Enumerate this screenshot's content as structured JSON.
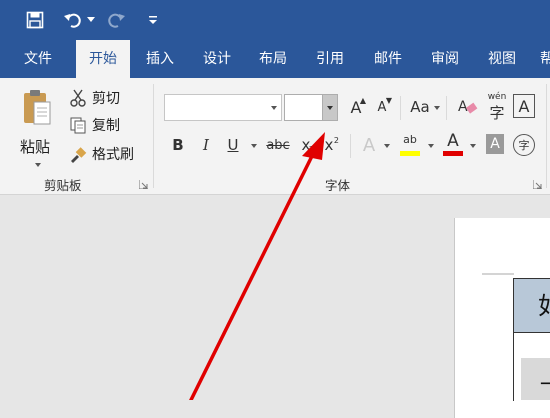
{
  "quick_access": {
    "save_icon": "save-icon",
    "undo_icon": "undo-icon",
    "redo_icon": "redo-icon",
    "customize_icon": "customize-qat-icon"
  },
  "tabs": [
    "文件",
    "开始",
    "插入",
    "设计",
    "布局",
    "引用",
    "邮件",
    "审阅",
    "视图",
    "帮"
  ],
  "active_tab": "开始",
  "clipboard": {
    "paste": "粘贴",
    "cut": "剪切",
    "copy": "复制",
    "format_painter": "格式刷",
    "group_label": "剪贴板"
  },
  "font": {
    "font_name_value": "",
    "font_size_value": "",
    "grow_label": "A",
    "shrink_label": "A",
    "case_label": "Aa",
    "bold": "B",
    "italic": "I",
    "underline": "U",
    "strikethrough": "abc",
    "subscript": "x",
    "superscript": "x",
    "superscript_mark": "2",
    "text_effects": "A",
    "highlight_text": "ab",
    "font_color": "A",
    "shading": "A",
    "border_char": "A",
    "pinyin": "wén",
    "enclosed_char": "字",
    "group_label": "字体"
  },
  "document": {
    "cell_text": "如",
    "row2_text": "一"
  },
  "colors": {
    "title_blue": "#2b579a",
    "ribbon_bg": "#f3f3f3",
    "highlight_yellow": "#ffff00",
    "font_red": "#e00000",
    "annotation_red": "#e00000"
  }
}
